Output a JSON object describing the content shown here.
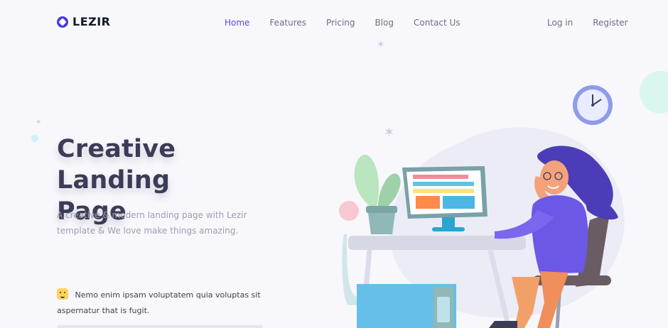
{
  "brand": {
    "name": "LEZIR",
    "logo_icon": "lezir-logo-icon",
    "colors": {
      "accent": "#5b49d6",
      "title": "#3b3c57",
      "muted": "#9aa0ad",
      "nav": "#6b7280"
    }
  },
  "nav": {
    "items": [
      {
        "label": "Home",
        "active": true
      },
      {
        "label": "Features",
        "active": false
      },
      {
        "label": "Pricing",
        "active": false
      },
      {
        "label": "Blog",
        "active": false
      },
      {
        "label": "Contact Us",
        "active": false
      }
    ],
    "auth": {
      "login_label": "Log in",
      "register_label": "Register"
    }
  },
  "hero": {
    "title_line1": "Creative Landing",
    "title_line2": "Page",
    "subtitle_line1": "A creative & modern landing page with Lezir",
    "subtitle_line2": "template & We love make things amazing."
  },
  "note": {
    "emoji_icon": "smiley-face-emoji-icon",
    "text_line1": "Nemo enim ipsam voluptatem quia voluptas sit",
    "text_line2": "aspernatur that is fugit."
  }
}
